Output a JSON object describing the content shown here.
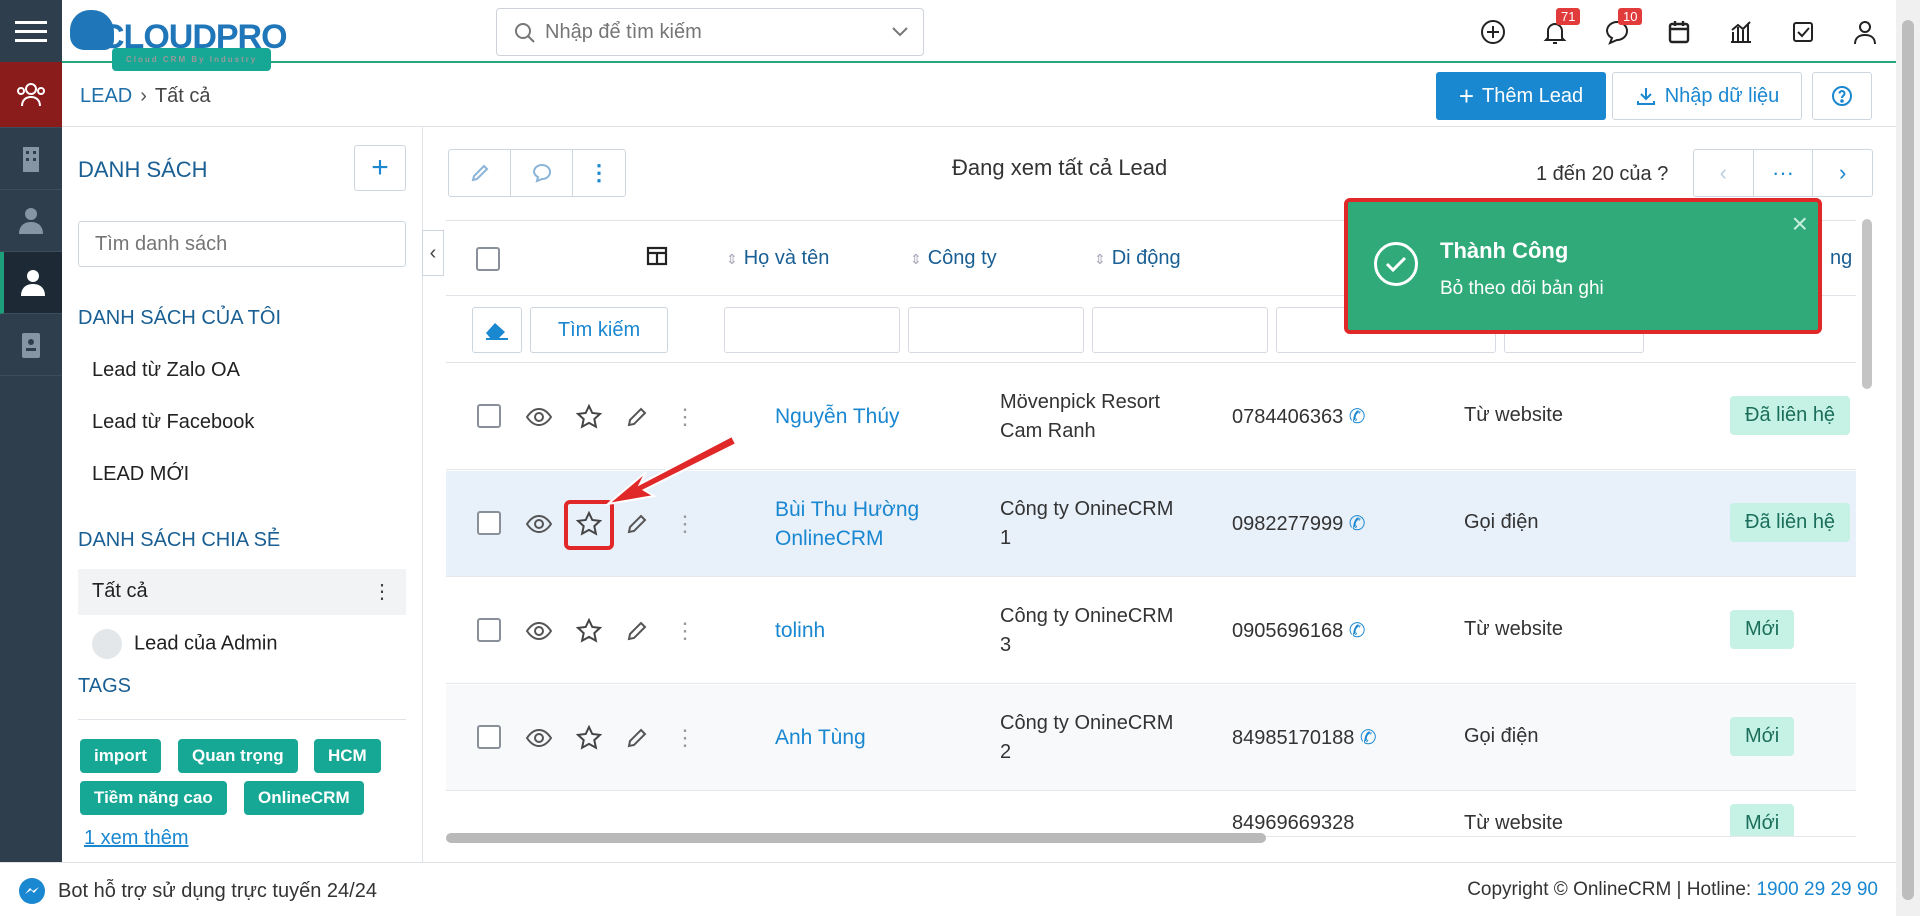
{
  "header": {
    "brand": "CLOUDPRO",
    "brand_tagline": "Cloud CRM By Industry",
    "search_placeholder": "Nhập để tìm kiếm",
    "notif_count": "71",
    "chat_count": "10"
  },
  "breadcrumb": {
    "module": "LEAD",
    "current": "Tất cả"
  },
  "actions": {
    "add_label": "Thêm Lead",
    "import_label": "Nhập dữ liệu"
  },
  "sidebar": {
    "title": "DANH SÁCH",
    "search_placeholder": "Tìm danh sách",
    "my_lists_title": "DANH SÁCH CỦA TÔI",
    "my_lists": [
      "Lead từ Zalo OA",
      "Lead từ Facebook",
      "LEAD MỚI"
    ],
    "shared_title": "DANH SÁCH CHIA SẺ",
    "shared": [
      "Tất cả",
      "Lead của Admin"
    ],
    "tags_title": "TAGS",
    "tags": [
      "import",
      "Quan trọng",
      "HCM",
      "Tiềm năng cao",
      "OnlineCRM"
    ],
    "more_link": "1  xem thêm"
  },
  "list": {
    "viewing_prefix": "Đang xem tất cả",
    "viewing_module": "Lead",
    "paging": "1 đến 20 của",
    "paging_unknown": "?",
    "search_button": "Tìm kiếm",
    "columns": [
      "Họ và tên",
      "Công ty",
      "Di động",
      "ng"
    ],
    "rows": [
      {
        "name": "Nguyễn Thúy",
        "company": "Mövenpick Resort Cam Ranh",
        "phone": "0784406363",
        "source": "Từ website",
        "status": "Đã liên hệ"
      },
      {
        "name": "Bùi Thu Hường OnlineCRM",
        "company": "Công ty OnineCRM 1",
        "phone": "0982277999",
        "source": "Gọi điện",
        "status": "Đã liên hệ"
      },
      {
        "name": "tolinh",
        "company": "Công ty OnineCRM 3",
        "phone": "0905696168",
        "source": "Từ website",
        "status": "Mới"
      },
      {
        "name": "Anh Tùng",
        "company": "Công ty OnineCRM 2",
        "phone": "84985170188",
        "source": "Gọi điện",
        "status": "Mới"
      },
      {
        "name": "",
        "company": "",
        "phone": "84969669328",
        "source": "Từ website",
        "status": "Mới"
      }
    ]
  },
  "toast": {
    "title": "Thành Công",
    "message": "Bỏ theo dõi bản ghi"
  },
  "footer": {
    "bot": "Bot hỗ trợ sử dụng trực tuyến 24/24",
    "copyright": "Copyright © OnlineCRM",
    "hotline_label": "Hotline:",
    "hotline": "1900 29 29 90"
  },
  "colors": {
    "primary": "#1a87d1",
    "success": "#2faa78",
    "rail": "#2f3e4c",
    "highlight": "#e02828"
  }
}
